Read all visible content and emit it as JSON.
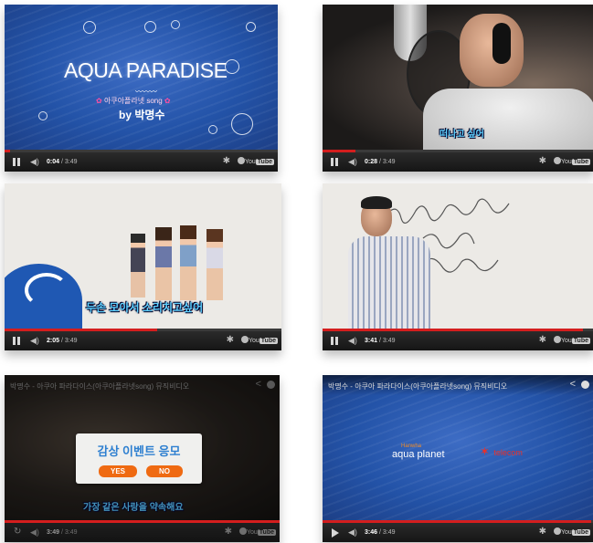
{
  "panels": [
    {
      "title": "AQUA PARADISE",
      "subtitle_line": "아쿠아플라넷 song",
      "byline": "by 박명수",
      "time_current": "0:04",
      "time_total": "3:49",
      "progress": 0.02
    },
    {
      "lyric": "떠나고 싶어",
      "time_current": "0:28",
      "time_total": "3:49",
      "progress": 0.12
    },
    {
      "lyric": "두손 모아서 소리치고싶어",
      "time_current": "2:05",
      "time_total": "3:49",
      "progress": 0.55
    },
    {
      "time_current": "3:41",
      "time_total": "3:49",
      "progress": 0.96
    },
    {
      "video_title": "박명수 - 아쿠아 파라다이스(아쿠아플라넷song) 뮤직비디오",
      "dialog_title": "감상 이벤트 응모",
      "yes": "YES",
      "no": "NO",
      "lyric": "가장 같은 사랑을 약속해요",
      "time_current": "3:49",
      "time_total": "3:49",
      "progress": 1.0
    },
    {
      "video_title": "박명수 - 아쿠아 파라다이스(아쿠아플라넷song) 뮤직비디오",
      "brand_small": "Hanwha",
      "brand_main": "aqua planet",
      "partner": "telecom",
      "time_current": "3:46",
      "time_total": "3:49",
      "progress": 0.99
    }
  ],
  "player": {
    "separator": " / ",
    "youtube_you": "You",
    "youtube_tube": "Tube"
  },
  "colors": {
    "progress": "#d41e1e",
    "aqua_blue": "#2352a8",
    "lyric": "#5fd2ff",
    "button_orange": "#ef6a12"
  }
}
